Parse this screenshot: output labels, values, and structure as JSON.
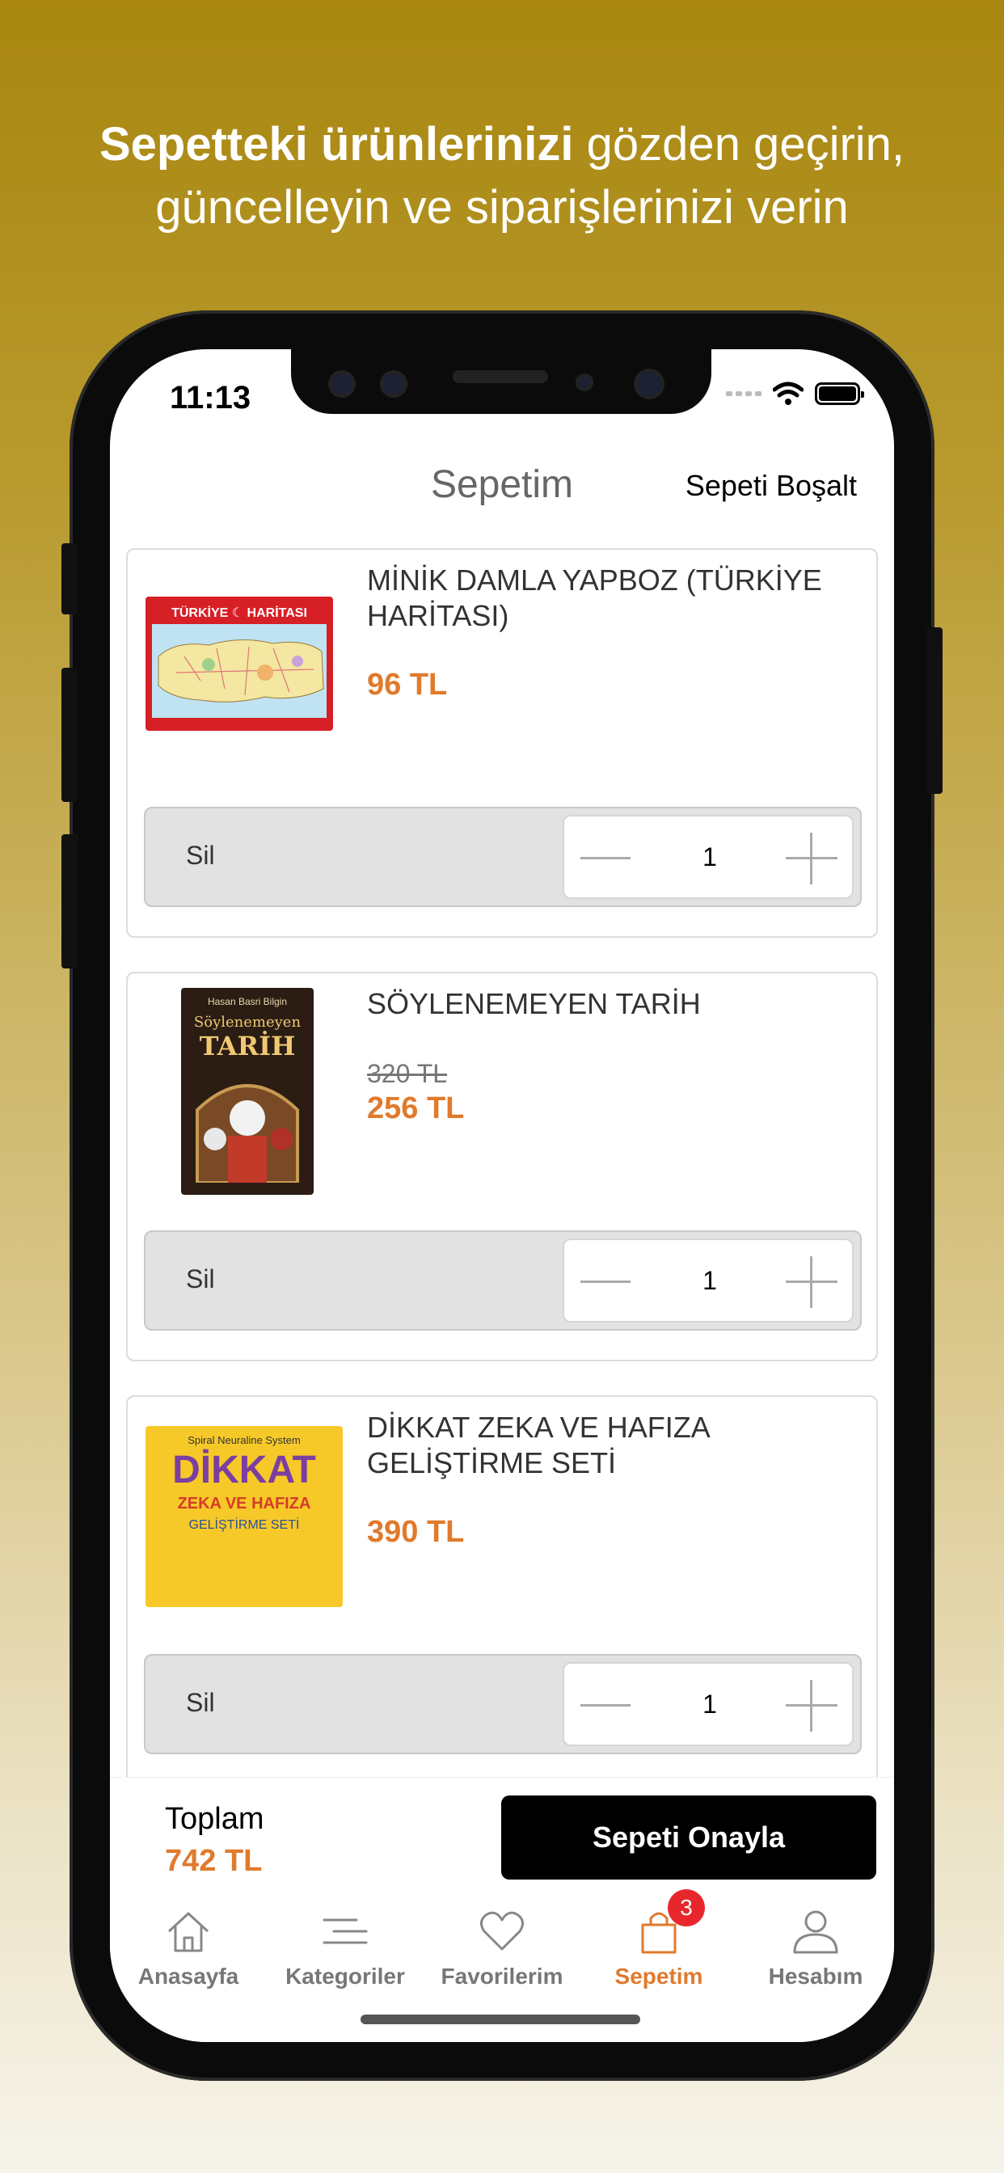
{
  "headline": {
    "bold": "Sepetteki ürünlerinizi",
    "rest_line1": " gözden geçirin,",
    "line2": "güncelleyin ve siparişlerinizi verin"
  },
  "status_bar": {
    "time": "11:13"
  },
  "nav": {
    "title": "Sepetim",
    "clear_label": "Sepeti Boşalt"
  },
  "items": [
    {
      "name": "MİNİK DAMLA YAPBOZ (TÜRKİYE HARİTASI)",
      "old_price": "",
      "price": "96 TL",
      "thumb_text": "TÜRKİYE ☾ HARİTASI",
      "delete_label": "Sil",
      "quantity": "1"
    },
    {
      "name": "SÖYLENEMEYEN TARİH",
      "old_price": "320 TL",
      "price": "256 TL",
      "thumb_author": "Hasan Basri Bilgin",
      "thumb_title_1": "Söylenemeyen",
      "thumb_title_2": "TARİH",
      "delete_label": "Sil",
      "quantity": "1"
    },
    {
      "name": "DİKKAT ZEKA VE HAFIZA GELİŞTİRME SETİ",
      "old_price": "",
      "price": "390 TL",
      "thumb_line1": "Spiral Neuraline System",
      "thumb_line2": "DİKKAT",
      "thumb_line3": "ZEKA VE HAFIZA",
      "thumb_line4": "GELİŞTİRME SETİ",
      "delete_label": "Sil",
      "quantity": "1"
    }
  ],
  "footer": {
    "total_label": "Toplam",
    "total_value": "742 TL",
    "confirm_label": "Sepeti Onayla"
  },
  "tabs": [
    {
      "label": "Anasayfa",
      "icon": "home-icon"
    },
    {
      "label": "Kategoriler",
      "icon": "list-icon"
    },
    {
      "label": "Favorilerim",
      "icon": "heart-icon"
    },
    {
      "label": "Sepetim",
      "icon": "bag-icon",
      "badge": "3",
      "active": true
    },
    {
      "label": "Hesabım",
      "icon": "user-icon"
    }
  ],
  "colors": {
    "accent": "#e07a2c",
    "badge": "#e8272c",
    "background_top": "#a8860f"
  }
}
